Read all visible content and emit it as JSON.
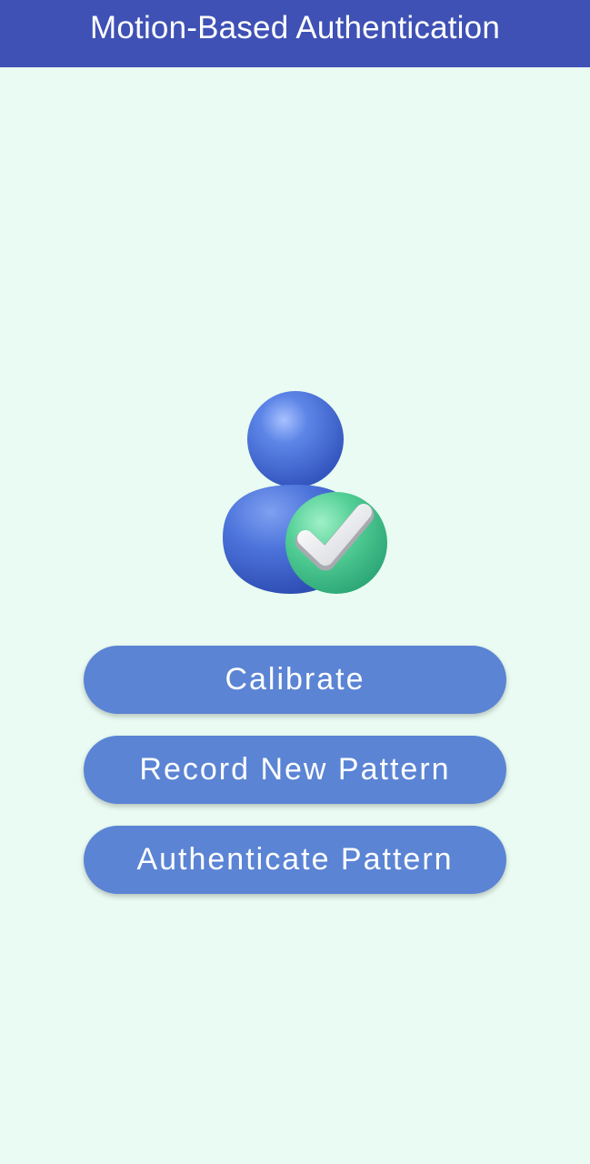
{
  "app": {
    "title": "Motion-Based Authentication"
  },
  "hero": {
    "icon": "user-verified-icon"
  },
  "actions": [
    {
      "label": "Calibrate"
    },
    {
      "label": "Record New Pattern"
    },
    {
      "label": "Authenticate Pattern"
    }
  ],
  "colors": {
    "app_bar": "#3f51b5",
    "background": "#e9fbf2",
    "button": "#5b84d4",
    "button_text": "#ffffff",
    "avatar_blue": "#4a74d8",
    "badge_green": "#4cc995"
  }
}
